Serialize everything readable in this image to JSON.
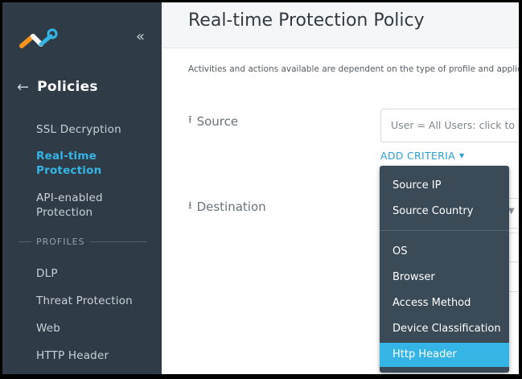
{
  "sidebar": {
    "collapse_icon": "double-chevron-left-icon",
    "back_icon": "arrow-left-icon",
    "title": "Policies",
    "items": [
      {
        "label": "SSL Decryption",
        "active": false
      },
      {
        "label": "Real-time\nProtection",
        "active": true
      },
      {
        "label": "API-enabled\nProtection",
        "active": false
      }
    ],
    "profiles_header": "PROFILES",
    "profiles": [
      {
        "label": "DLP"
      },
      {
        "label": "Threat Protection"
      },
      {
        "label": "Web"
      },
      {
        "label": "HTTP Header"
      }
    ]
  },
  "main": {
    "title": "Real-time Protection Policy",
    "notice": "Activities and actions available are dependent on the type of profile and applica",
    "source_label": "Source",
    "source_icon": "upload-arrow-icon",
    "source_input_value": "User = All Users: click to sele",
    "add_criteria_label": "ADD CRITERIA",
    "destination_label": "Destination",
    "destination_icon": "download-arrow-icon"
  },
  "dropdown": {
    "items": [
      {
        "label": "Source IP"
      },
      {
        "label": "Source Country"
      },
      {
        "label": "OS"
      },
      {
        "label": "Browser"
      },
      {
        "label": "Access Method"
      },
      {
        "label": "Device Classification"
      },
      {
        "label": "Http Header",
        "selected": true
      }
    ]
  },
  "colors": {
    "sidebar_bg": "#2f3c47",
    "accent": "#35b5e5",
    "dropdown_bg": "#3a4a57",
    "logo_orange": "#f7941d",
    "logo_blue": "#35b5e5"
  }
}
